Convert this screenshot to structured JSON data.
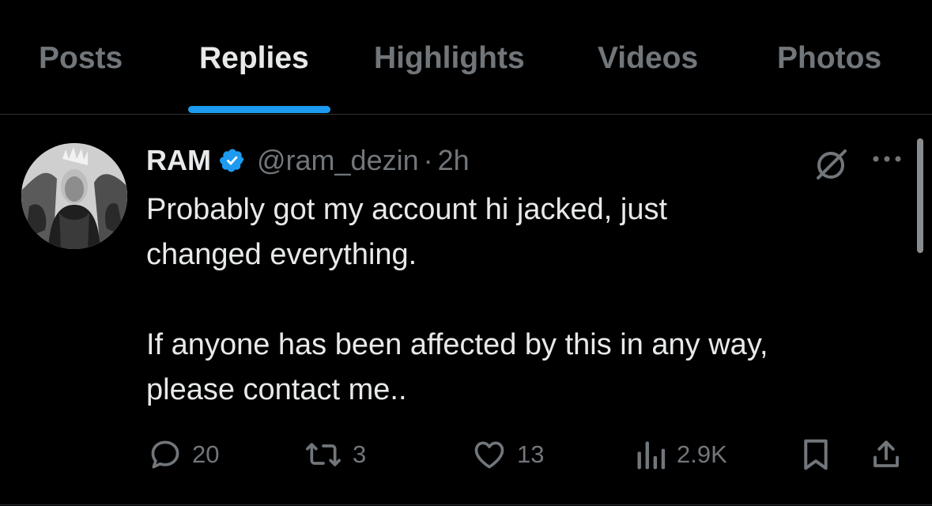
{
  "tabs": [
    {
      "label": "Posts",
      "active": false
    },
    {
      "label": "Replies",
      "active": true
    },
    {
      "label": "Highlights",
      "active": false
    },
    {
      "label": "Videos",
      "active": false
    },
    {
      "label": "Photos",
      "active": false
    }
  ],
  "colors": {
    "background": "#000000",
    "primary_text": "#e7e9ea",
    "secondary_text": "#71767b",
    "accent": "#1d9bf0",
    "divider": "#2f3336"
  },
  "tweet": {
    "display_name": "RAM",
    "verified_icon": "verified-badge-icon",
    "handle": "@ram_dezin",
    "separator": "·",
    "timestamp": "2h",
    "text": "Probably got my account hi jacked, just\nchanged everything.\n\nIf anyone has been affected by this in any way,\nplease contact me..",
    "header_icons": [
      "grok-icon",
      "more-icon"
    ],
    "actions": {
      "reply": {
        "icon": "reply-icon",
        "count": "20"
      },
      "retweet": {
        "icon": "retweet-icon",
        "count": "3"
      },
      "like": {
        "icon": "heart-icon",
        "count": "13"
      },
      "views": {
        "icon": "views-icon",
        "count": "2.9K"
      },
      "bookmark": {
        "icon": "bookmark-icon"
      },
      "share": {
        "icon": "share-icon"
      }
    }
  }
}
